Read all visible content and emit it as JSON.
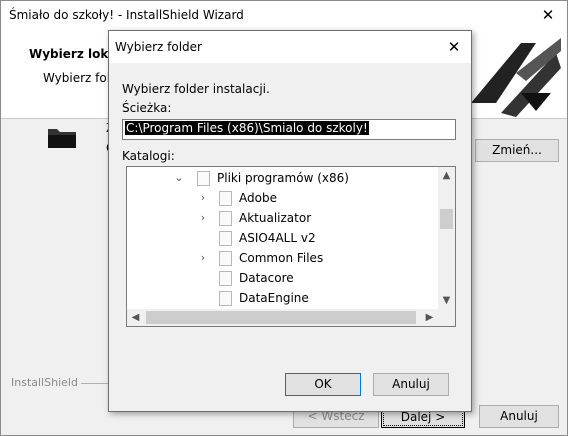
{
  "wizard": {
    "title": "Śmiało do szkoły! - InstallShield Wizard",
    "close_glyph": "✕",
    "header_title": "Wybierz lokalizację",
    "header_subtitle": "Wybierz folder",
    "partial_text_1": "Z",
    "partial_text_2": "C",
    "change_button": "Zmień...",
    "brand_label": "InstallShield",
    "back_button": "< Wstecz",
    "next_button": "Dalej >",
    "cancel_button": "Anuluj"
  },
  "dialog": {
    "title": "Wybierz folder",
    "close_glyph": "✕",
    "instruction": "Wybierz folder instalacji.",
    "path_label": "Ścieżka:",
    "path_value": "C:\\Program Files (x86)\\Smialo do szkoly!",
    "dirs_label": "Katalogi:",
    "ok_button": "OK",
    "cancel_button": "Anuluj"
  },
  "tree": {
    "items": [
      {
        "label": "Pliki programów (x86)",
        "chevron": "⌄",
        "level": 0
      },
      {
        "label": "Adobe",
        "chevron": "›",
        "level": 1
      },
      {
        "label": "Aktualizator",
        "chevron": "›",
        "level": 1
      },
      {
        "label": "ASIO4ALL v2",
        "chevron": "",
        "level": 1
      },
      {
        "label": "Common Files",
        "chevron": "›",
        "level": 1
      },
      {
        "label": "Datacore",
        "chevron": "",
        "level": 1
      },
      {
        "label": "DataEngine",
        "chevron": "",
        "level": 1
      }
    ]
  },
  "scrollbars": {
    "up": "▲",
    "down": "▼",
    "left": "◀",
    "right": "▶"
  },
  "colors": {
    "selection": "#000000",
    "ok_border": "#0078d7"
  }
}
